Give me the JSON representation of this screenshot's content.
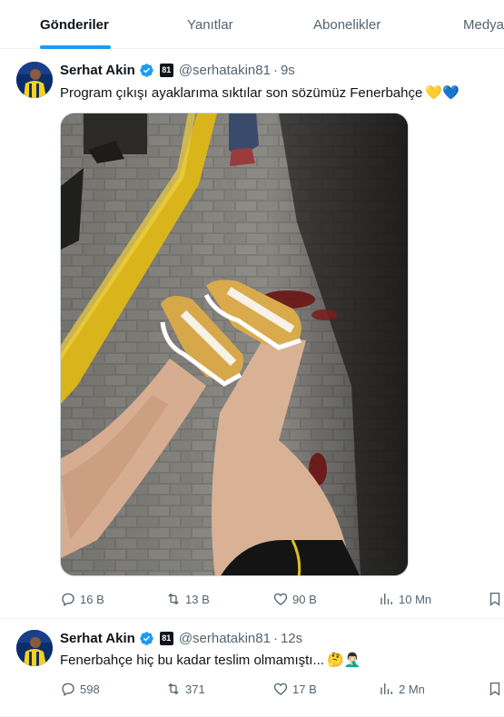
{
  "tabs": [
    {
      "label": "Gönderiler",
      "active": true
    },
    {
      "label": "Yanıtlar",
      "active": false
    },
    {
      "label": "Abonelikler",
      "active": false
    },
    {
      "label": "Medya",
      "active": false
    }
  ],
  "accent_color": "#1d9bf0",
  "tweets": [
    {
      "name": "Serhat Akin",
      "badge": "81",
      "handle": "@serhatakin81",
      "separator": "·",
      "time": "9s",
      "text": "Program çıkışı ayaklarıma sıktılar son sözümüz Fenerbahçe",
      "emojis": "💛💙",
      "media_icon": "photo",
      "replies": "16 B",
      "reposts": "13 B",
      "likes": "90 B",
      "views": "10 Mn"
    },
    {
      "name": "Serhat Akin",
      "badge": "81",
      "handle": "@serhatakin81",
      "separator": "·",
      "time": "12s",
      "text": "Fenerbahçe hiç bu kadar teslim olmamıştı...",
      "emojis": "🤔🤦🏻‍♂️",
      "replies": "598",
      "reposts": "371",
      "likes": "17 B",
      "views": "2 Mn"
    }
  ]
}
